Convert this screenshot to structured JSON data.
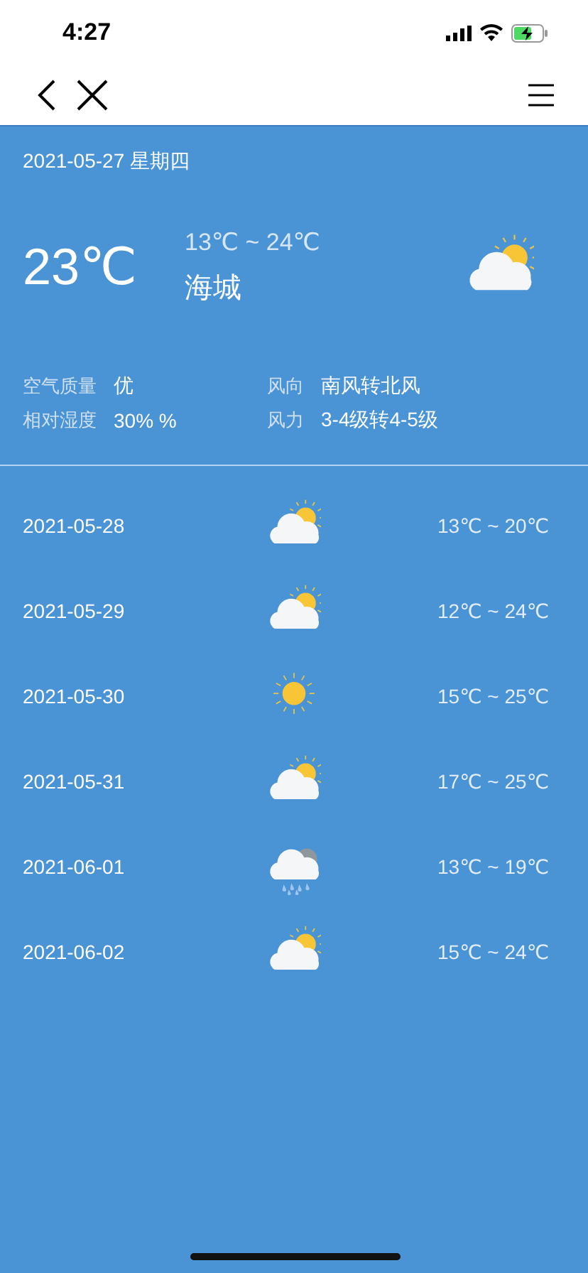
{
  "status_bar": {
    "time": "4:27"
  },
  "today": {
    "date": "2021-05-27 星期四",
    "temp": "23℃",
    "range": "13℃ ~ 24℃",
    "city": "海城",
    "kind": "partly_cloudy",
    "details": [
      {
        "label": "空气质量",
        "value": "优"
      },
      {
        "label": "风向",
        "value": "南风转北风"
      },
      {
        "label": "相对湿度",
        "value": "30% %"
      },
      {
        "label": "风力",
        "value": "3-4级转4-5级"
      }
    ]
  },
  "forecast": [
    {
      "date": "2021-05-28",
      "kind": "partly_cloudy",
      "range": "13℃ ~ 20℃"
    },
    {
      "date": "2021-05-29",
      "kind": "partly_cloudy",
      "range": "12℃ ~ 24℃"
    },
    {
      "date": "2021-05-30",
      "kind": "sunny",
      "range": "15℃ ~ 25℃"
    },
    {
      "date": "2021-05-31",
      "kind": "partly_cloudy",
      "range": "17℃ ~ 25℃"
    },
    {
      "date": "2021-06-01",
      "kind": "rain",
      "range": "13℃ ~ 19℃"
    },
    {
      "date": "2021-06-02",
      "kind": "partly_cloudy",
      "range": "15℃ ~ 24℃"
    }
  ]
}
